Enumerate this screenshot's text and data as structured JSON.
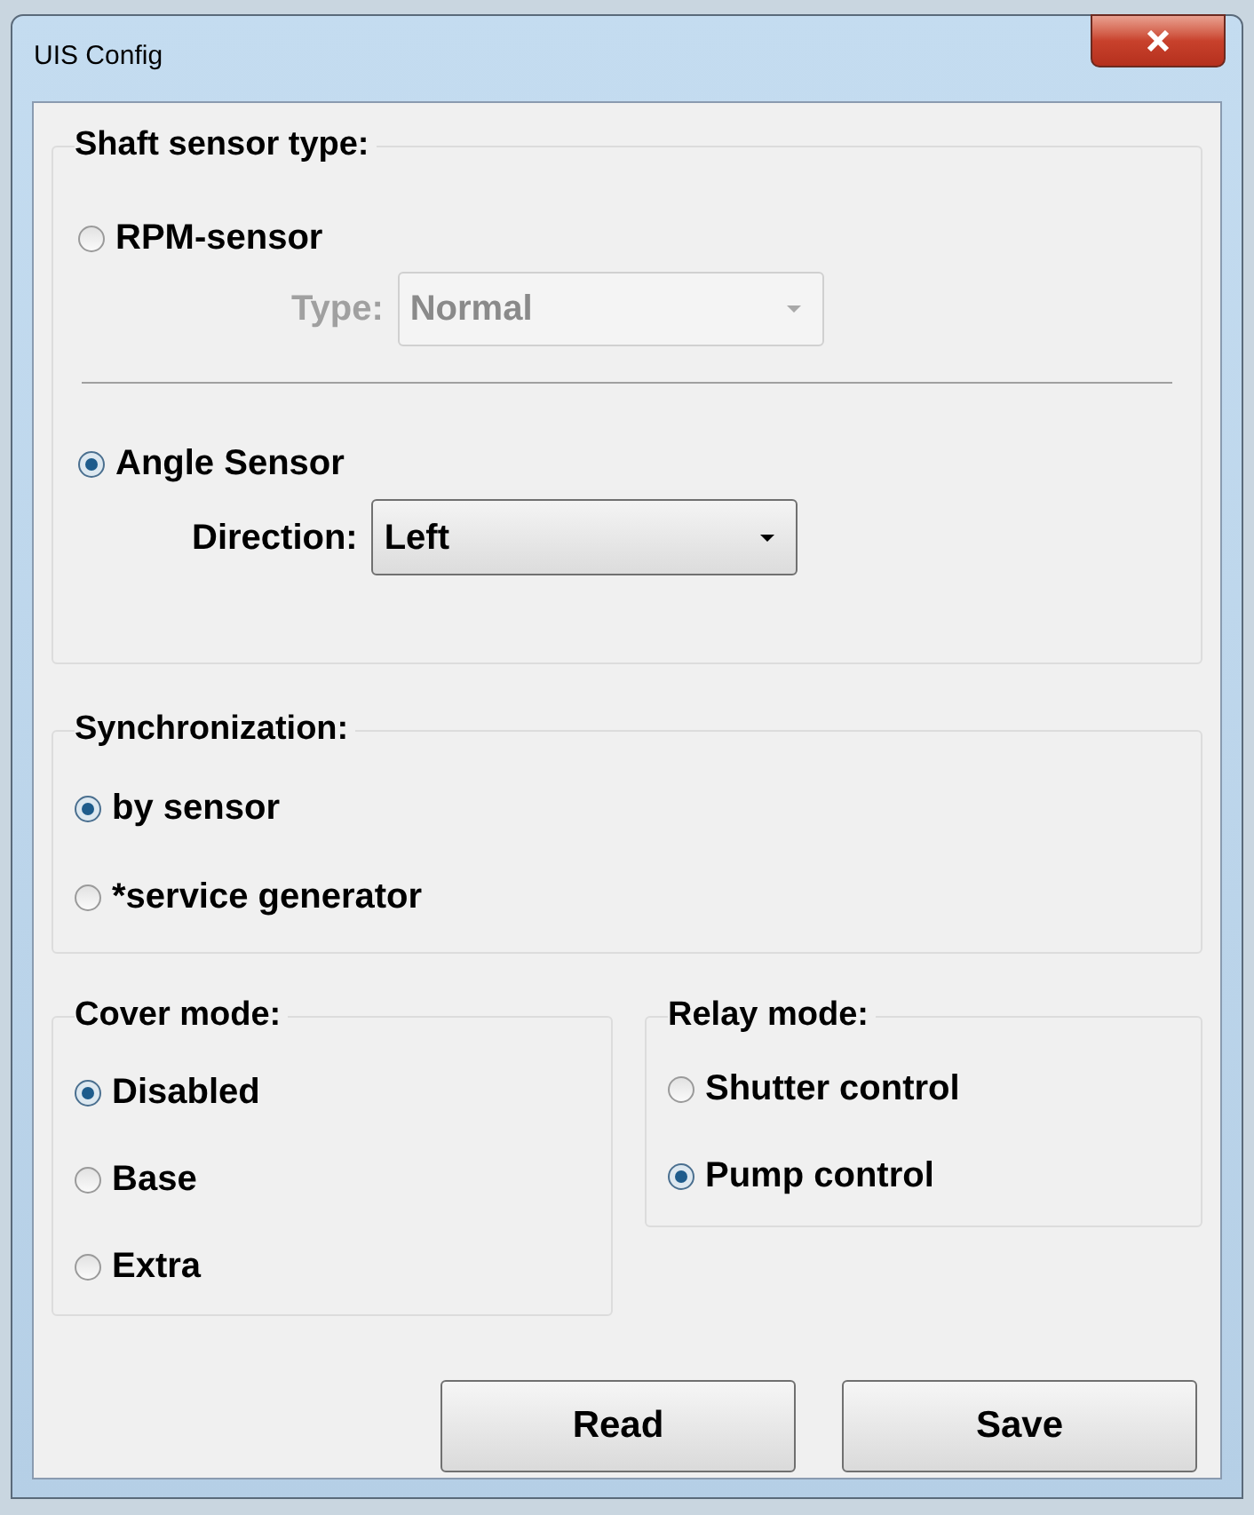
{
  "window": {
    "title": "UIS Config"
  },
  "shaft_sensor_type": {
    "title": "Shaft sensor type:",
    "options": [
      {
        "label": "RPM-sensor",
        "selected": false,
        "dropdown": {
          "label": "Type:",
          "value": "Normal",
          "disabled": true
        }
      },
      {
        "label": "Angle Sensor",
        "selected": true,
        "dropdown": {
          "label": "Direction:",
          "value": "Left",
          "disabled": false
        }
      }
    ]
  },
  "synchronization": {
    "title": "Synchronization:",
    "options": [
      {
        "label": "by sensor",
        "selected": true
      },
      {
        "label": "*service generator",
        "selected": false
      }
    ]
  },
  "cover_mode": {
    "title": "Cover mode:",
    "options": [
      {
        "label": "Disabled",
        "selected": true
      },
      {
        "label": "Base",
        "selected": false
      },
      {
        "label": "Extra",
        "selected": false
      }
    ]
  },
  "relay_mode": {
    "title": "Relay mode:",
    "options": [
      {
        "label": "Shutter control",
        "selected": false
      },
      {
        "label": "Pump control",
        "selected": true
      }
    ]
  },
  "buttons": [
    "Read",
    "Save"
  ]
}
